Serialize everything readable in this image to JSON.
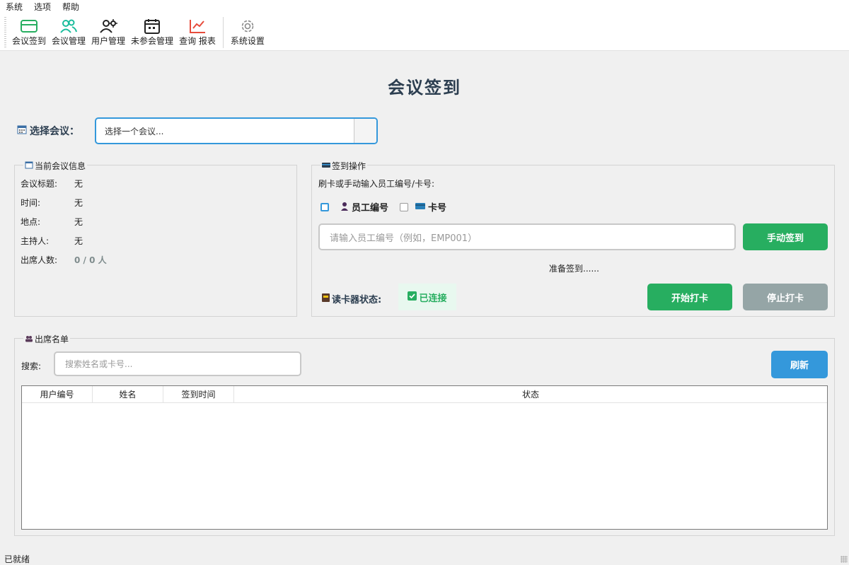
{
  "menu": [
    "系统",
    "选项",
    "帮助"
  ],
  "toolbar": {
    "items": [
      {
        "label": "会议签到",
        "icon": "card-icon"
      },
      {
        "label": "会议管理",
        "icon": "users-icon"
      },
      {
        "label": "用户管理",
        "icon": "user-gear-icon"
      },
      {
        "label": "未参会管理",
        "icon": "calendar-icon"
      },
      {
        "label": "查询 报表",
        "icon": "chart-icon"
      }
    ],
    "settings": {
      "label": "系统设置",
      "icon": "gear-icon"
    }
  },
  "page_title": "会议签到",
  "meeting_select": {
    "label": "选择会议：",
    "value": "选择一个会议..."
  },
  "info": {
    "title": "当前会议信息",
    "rows": [
      {
        "key": "会议标题:",
        "value": "无"
      },
      {
        "key": "时间:",
        "value": "无"
      },
      {
        "key": "地点:",
        "value": "无"
      },
      {
        "key": "主持人:",
        "value": "无"
      },
      {
        "key": "出席人数:",
        "value": "0 / 0 人"
      }
    ]
  },
  "checkin": {
    "title": "签到操作",
    "hint": "刷卡或手动输入员工编号/卡号:",
    "option_employee": "员工编号",
    "option_card": "卡号",
    "input_placeholder": "请输入员工编号（例如，EMP001）",
    "manual_button": "手动签到",
    "status_text": "准备签到......",
    "reader_label": "读卡器状态:",
    "reader_status": "已连接",
    "start_button": "开始打卡",
    "stop_button": "停止打卡"
  },
  "attendance": {
    "title": "出席名单",
    "search_label": "搜索:",
    "search_placeholder": "搜索姓名或卡号...",
    "refresh_button": "刷新",
    "columns": [
      "用户编号",
      "姓名",
      "签到时间",
      "状态"
    ],
    "rows": []
  },
  "statusbar": "已就绪",
  "colors": {
    "accent": "#3498db",
    "green": "#27ae60",
    "grey": "#95a5a6",
    "title": "#2c3e50"
  }
}
